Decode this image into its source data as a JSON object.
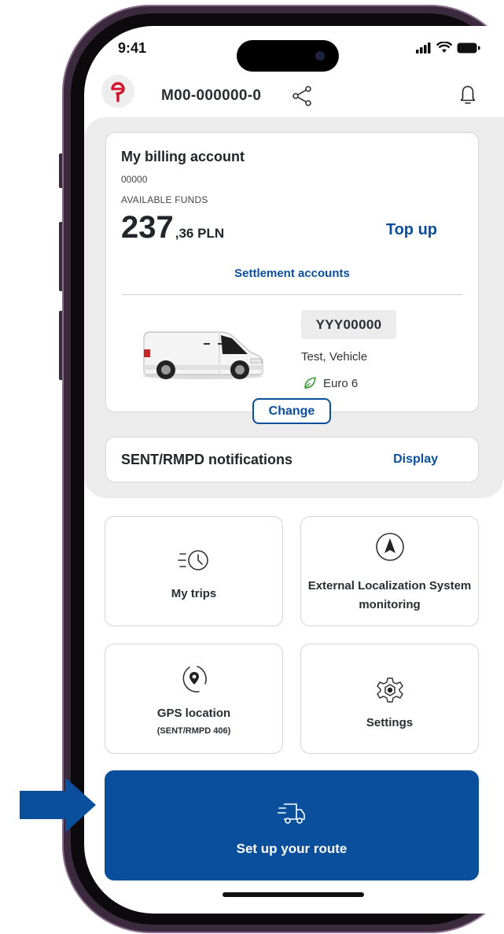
{
  "status_bar": {
    "time": "9:41"
  },
  "header": {
    "account_id": "M00-000000-0"
  },
  "billing": {
    "title": "My billing account",
    "account_number": "00000",
    "funds_label": "AVAILABLE FUNDS",
    "amount_integer": "237",
    "amount_decimal": ",36 PLN",
    "top_up_label": "Top up",
    "settlement_label": "Settlement accounts"
  },
  "vehicle": {
    "plate": "YYY00000",
    "name": "Test, Vehicle",
    "emission_class": "Euro 6",
    "change_label": "Change"
  },
  "notifications": {
    "label": "SENT/RMPD notifications",
    "display_label": "Display"
  },
  "tiles": [
    {
      "label": "My trips",
      "icon": "trips-clock-icon"
    },
    {
      "label": "External Localization System monitoring",
      "icon": "navigation-arrow-icon"
    },
    {
      "label": "GPS location",
      "sub": "(SENT/RMPD 406)",
      "icon": "location-pin-icon"
    },
    {
      "label": "Settings",
      "icon": "gear-icon"
    }
  ],
  "route": {
    "label": "Set up your route",
    "icon": "delivery-truck-icon"
  },
  "colors": {
    "brand_blue": "#0a4f9c",
    "logo_red": "#d2142c",
    "eco_green": "#3a9a3a",
    "frame": "#3b2a3e"
  }
}
